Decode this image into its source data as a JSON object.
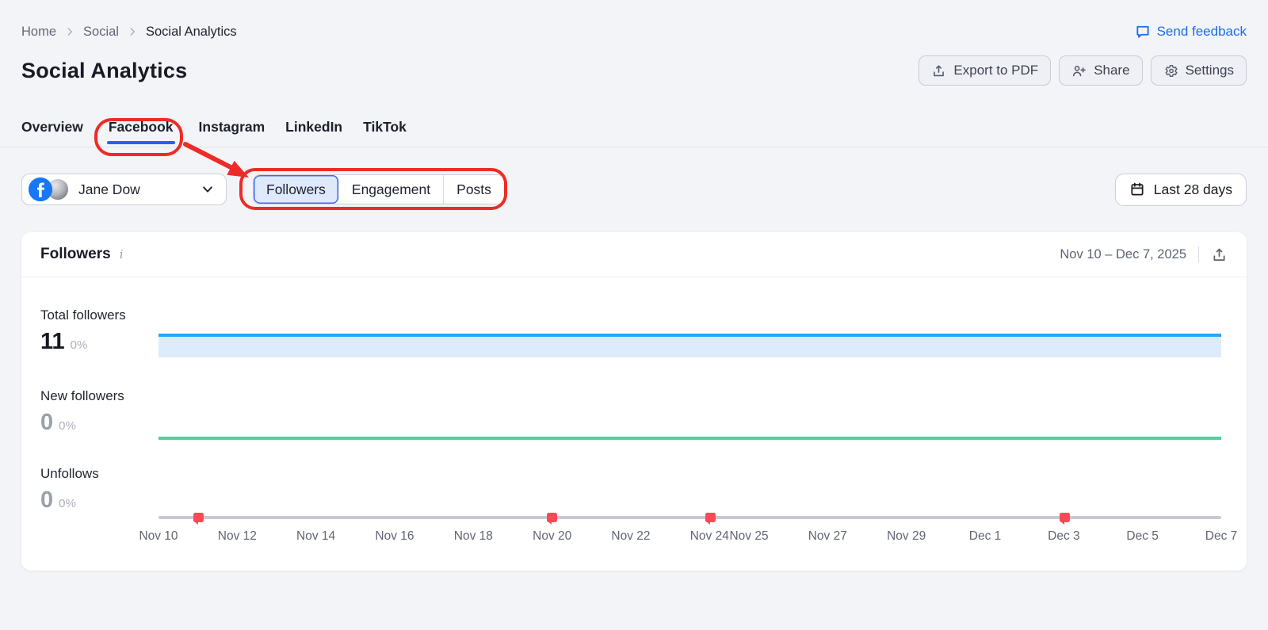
{
  "breadcrumb": {
    "items": [
      "Home",
      "Social",
      "Social Analytics"
    ]
  },
  "feedback": {
    "label": "Send feedback",
    "icon": "chat-bubble-icon"
  },
  "header": {
    "title": "Social Analytics",
    "actions": [
      {
        "label": "Export to PDF",
        "icon": "upload-icon"
      },
      {
        "label": "Share",
        "icon": "person-plus-icon"
      },
      {
        "label": "Settings",
        "icon": "gear-icon"
      }
    ]
  },
  "tabs": {
    "items": [
      {
        "label": "Overview",
        "active": false
      },
      {
        "label": "Facebook",
        "active": true
      },
      {
        "label": "Instagram",
        "active": false
      },
      {
        "label": "LinkedIn",
        "active": false
      },
      {
        "label": "TikTok",
        "active": false
      }
    ],
    "active_tab": "Facebook"
  },
  "profile": {
    "name": "Jane Dow",
    "network": "Facebook"
  },
  "segments": {
    "items": [
      {
        "label": "Followers",
        "active": true
      },
      {
        "label": "Engagement",
        "active": false
      },
      {
        "label": "Posts",
        "active": false
      }
    ],
    "active_segment": "Followers"
  },
  "date_filter": {
    "label": "Last 28 days",
    "icon": "calendar-icon"
  },
  "card": {
    "title": "Followers",
    "date_range": "Nov 10 – Dec 7, 2025",
    "metrics": [
      {
        "label": "Total followers",
        "value": "11",
        "change": "0%"
      },
      {
        "label": "New followers",
        "value": "0",
        "change": "0%"
      },
      {
        "label": "Unfollows",
        "value": "0",
        "change": "0%"
      }
    ]
  },
  "chart_data": {
    "type": "line",
    "title": "Followers",
    "date_range": "Nov 10 – Dec 7, 2025",
    "grid": "off",
    "legend": "none",
    "x_tick_labels": [
      "Nov 10",
      "Nov 12",
      "Nov 14",
      "Nov 16",
      "Nov 18",
      "Nov 20",
      "Nov 22",
      "Nov 24",
      "Nov 25",
      "Nov 27",
      "Nov 29",
      "Dec 1",
      "Dec 3",
      "Dec 5",
      "Dec 7"
    ],
    "x_tick_pct": [
      0,
      7.41,
      14.81,
      22.22,
      29.63,
      37.04,
      44.44,
      51.85,
      55.56,
      62.96,
      70.37,
      77.78,
      85.19,
      92.59,
      100
    ],
    "series": [
      {
        "name": "Total followers",
        "style": "area",
        "constant_value": 11,
        "change": "0%",
        "line_color": "#27a6f6",
        "fill_color": "#dcecfc"
      },
      {
        "name": "New followers",
        "style": "line",
        "constant_value": 0,
        "change": "0%",
        "line_color": "#4ed19c"
      },
      {
        "name": "Unfollows",
        "style": "line",
        "constant_value": 0,
        "change": "0%",
        "line_color": "#c7cad3",
        "post_markers": {
          "color": "#fb4956",
          "dates": [
            "Nov 11",
            "Nov 20",
            "Nov 24",
            "Dec 3"
          ],
          "pct": [
            3.7,
            37.0,
            51.9,
            85.2
          ]
        }
      }
    ]
  },
  "annotations": {
    "color": "#ee2b26",
    "circled": [
      "Facebook tab",
      "Followers / Engagement / Posts switcher"
    ]
  }
}
